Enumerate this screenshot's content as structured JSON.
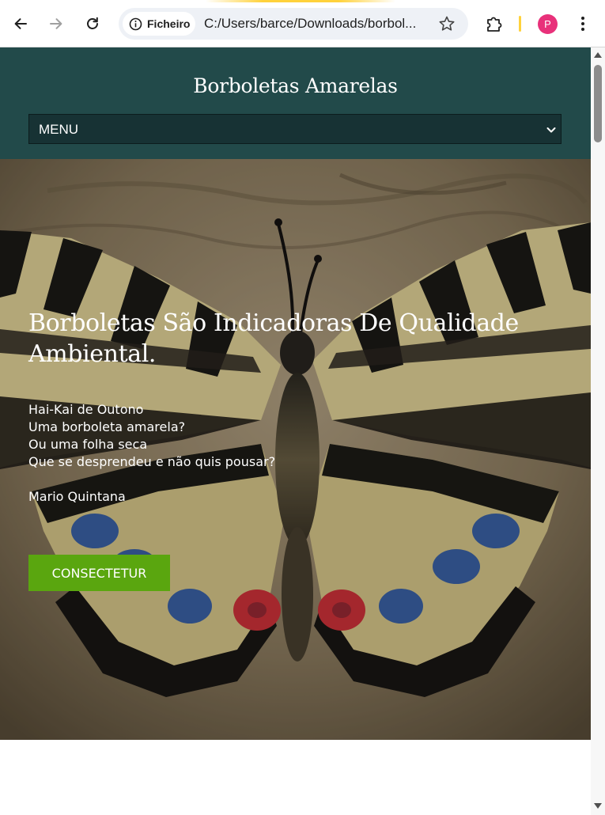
{
  "browser": {
    "site_chip_label": "Ficheiro",
    "url": "C:/Users/barce/Downloads/borbol...",
    "avatar_letter": "P",
    "avatar_color": "#e8317a",
    "icons": [
      "back-arrow-icon",
      "forward-arrow-icon",
      "reload-icon",
      "info-icon",
      "star-icon",
      "extensions-icon",
      "more-vert-icon"
    ]
  },
  "site": {
    "title": "Borboletas Amarelas",
    "menu_label": "MENU",
    "header_color": "#224a4a"
  },
  "hero": {
    "heading": "Borboletas São Indicadoras De Qualidade Ambiental.",
    "poem_lines": [
      "Hai-Kai de Outono",
      "Uma borboleta amarela?",
      "Ou uma folha seca",
      "Que se desprendeu e não quis pousar?"
    ],
    "author": "Mario Quintana",
    "button_label": "CONSECTETUR",
    "button_color": "#5aa60f"
  }
}
